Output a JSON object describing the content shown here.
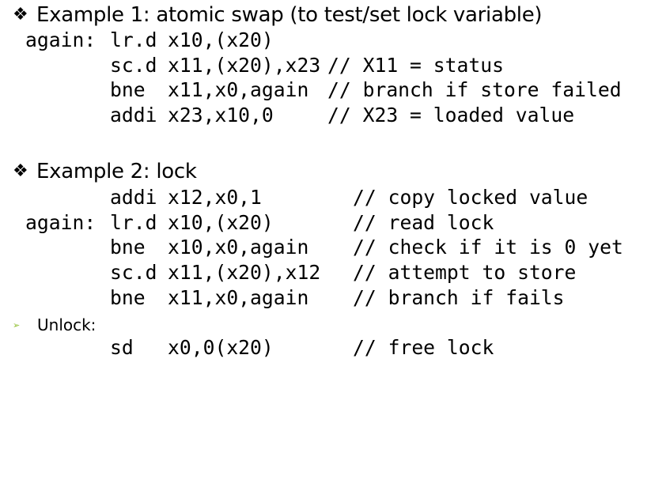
{
  "example1": {
    "bullet": "❖",
    "title": "Example 1: atomic swap (to test/set lock variable)",
    "lines": [
      {
        "label": "again:",
        "op": "lr.d",
        "args": "x10,(x20)",
        "comment": ""
      },
      {
        "label": "",
        "op": "sc.d",
        "args": "x11,(x20),x23",
        "comment": "// X11 = status"
      },
      {
        "label": "",
        "op": "bne",
        "args": "x11,x0,again",
        "comment": "// branch if store failed"
      },
      {
        "label": "",
        "op": "addi",
        "args": "x23,x10,0",
        "comment": "// X23 = loaded value"
      }
    ]
  },
  "example2": {
    "bullet": "❖",
    "title": "Example 2:  lock",
    "lines": [
      {
        "label": "",
        "op": "addi",
        "args": "x12,x0,1",
        "comment": "// copy locked value"
      },
      {
        "label": "again:",
        "op": "lr.d",
        "args": "x10,(x20)",
        "comment": "// read lock"
      },
      {
        "label": "",
        "op": "bne",
        "args": "x10,x0,again",
        "comment": "// check if it is 0 yet"
      },
      {
        "label": "",
        "op": "sc.d",
        "args": "x11,(x20),x12",
        "comment": "// attempt to store"
      },
      {
        "label": "",
        "op": "bne",
        "args": "x11,x0,again",
        "comment": "// branch if fails"
      }
    ]
  },
  "unlock": {
    "arrow": "➢",
    "label": "Unlock:",
    "lines": [
      {
        "label": "",
        "op": "sd",
        "args": "x0,0(x20)",
        "comment": "// free lock"
      }
    ]
  },
  "colors": {
    "text": "#000000",
    "sub_bullet": "#8fbf2e",
    "background": "#ffffff"
  }
}
